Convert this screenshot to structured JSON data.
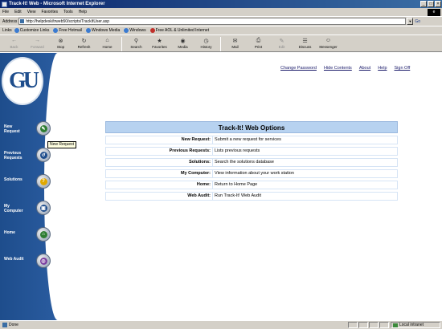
{
  "window": {
    "title": "Track-It! Web - Microsoft Internet Explorer",
    "buttons": [
      "_",
      "□",
      "×"
    ]
  },
  "menubar": {
    "items": [
      "File",
      "Edit",
      "View",
      "Favorites",
      "Tools",
      "Help"
    ]
  },
  "address": {
    "label": "Address",
    "url": "http://helpdesk/trweb50/scripts/TrackItUser.asp",
    "go": "Go"
  },
  "links": {
    "label": "Links",
    "items": [
      "Customize Links",
      "Free Hotmail",
      "Windows Media",
      "Windows",
      "Free AOL & Unlimited Internet"
    ]
  },
  "toolbar": {
    "buttons": [
      {
        "label": "Back",
        "icon": "back-arrow-icon",
        "glyph": "←",
        "disabled": true
      },
      {
        "label": "Forward",
        "icon": "forward-arrow-icon",
        "glyph": "→",
        "disabled": true
      },
      {
        "label": "Stop",
        "icon": "stop-icon",
        "glyph": "⊗",
        "disabled": false
      },
      {
        "label": "Refresh",
        "icon": "refresh-icon",
        "glyph": "↻",
        "disabled": false
      },
      {
        "label": "Home",
        "icon": "home-icon",
        "glyph": "⌂",
        "disabled": false
      },
      {
        "label": "Search",
        "icon": "search-icon",
        "glyph": "⚲",
        "disabled": false
      },
      {
        "label": "Favorites",
        "icon": "favorites-icon",
        "glyph": "★",
        "disabled": false
      },
      {
        "label": "Media",
        "icon": "media-icon",
        "glyph": "◉",
        "disabled": false
      },
      {
        "label": "History",
        "icon": "history-icon",
        "glyph": "◷",
        "disabled": false
      },
      {
        "label": "Mail",
        "icon": "mail-icon",
        "glyph": "✉",
        "disabled": false
      },
      {
        "label": "Print",
        "icon": "print-icon",
        "glyph": "⎙",
        "disabled": false
      },
      {
        "label": "Edit",
        "icon": "edit-icon",
        "glyph": "✎",
        "disabled": true
      },
      {
        "label": "Discuss",
        "icon": "discuss-icon",
        "glyph": "☰",
        "disabled": false
      },
      {
        "label": "Messenger",
        "icon": "messenger-icon",
        "glyph": "☺",
        "disabled": false
      }
    ]
  },
  "sidebar": {
    "logo": "GU",
    "items": [
      {
        "label": "New Request",
        "icon": "new-request-icon",
        "glyph": "✎",
        "color": "#2e7d32"
      },
      {
        "label": "Previous Requests",
        "icon": "previous-requests-icon",
        "glyph": "↺",
        "color": "#1e4d8c"
      },
      {
        "label": "Solutions",
        "icon": "solutions-icon",
        "glyph": "?",
        "color": "#e0a800"
      },
      {
        "label": "My Computer",
        "icon": "my-computer-icon",
        "glyph": "▣",
        "color": "#1e4d8c"
      },
      {
        "label": "Home",
        "icon": "home-icon",
        "glyph": "⌂",
        "color": "#2e7d32"
      },
      {
        "label": "Web Audit",
        "icon": "web-audit-icon",
        "glyph": "◎",
        "color": "#7b3fa0"
      }
    ],
    "tooltip": "New Request"
  },
  "toplinks": [
    "Change Password",
    "Hide Contents",
    "About",
    "Help",
    "Sign Off"
  ],
  "options": {
    "title": "Track-It! Web Options",
    "rows": [
      {
        "label": "New Request:",
        "desc": "Submit a new request for services"
      },
      {
        "label": "Previous Requests:",
        "desc": "Lists previous requests"
      },
      {
        "label": "Solutions:",
        "desc": "Search the solutions database"
      },
      {
        "label": "My Computer:",
        "desc": "View information about your work station"
      },
      {
        "label": "Home:",
        "desc": "Return to Home Page"
      },
      {
        "label": "Web Audit:",
        "desc": "Run Track-It! Web Audit"
      }
    ]
  },
  "status": {
    "text": "Done",
    "zone": "Local intranet"
  }
}
